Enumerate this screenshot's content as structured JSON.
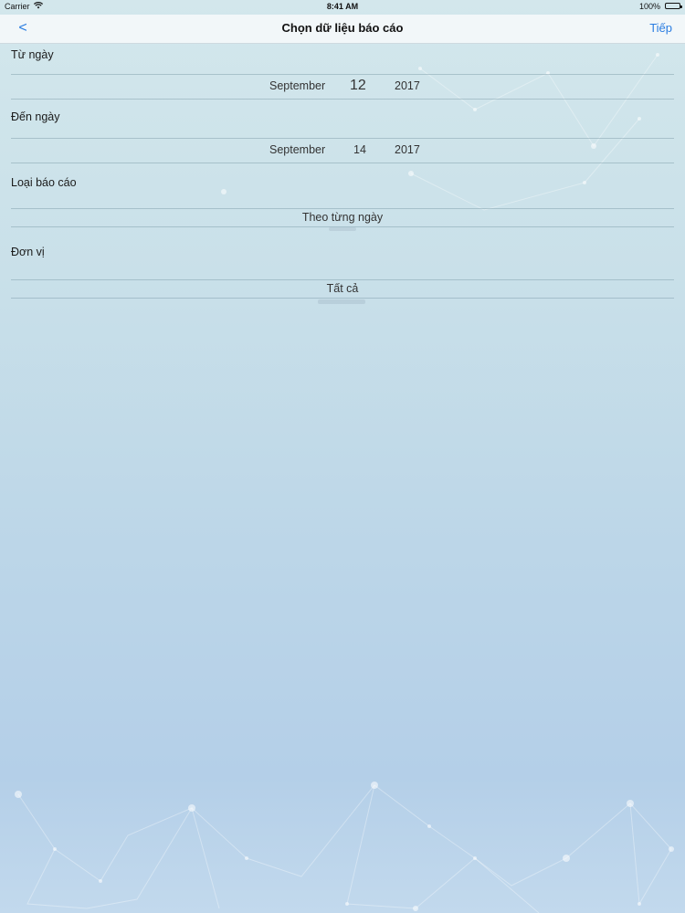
{
  "status_bar": {
    "carrier": "Carrier",
    "time": "8:41 AM",
    "battery": "100%"
  },
  "nav": {
    "back_label": "<",
    "title": "Chọn dữ liệu báo cáo",
    "next_label": "Tiếp"
  },
  "form": {
    "from_date": {
      "label": "Từ ngày",
      "month": "September",
      "day": "12",
      "year": "2017"
    },
    "to_date": {
      "label": "Đến ngày",
      "month": "September",
      "day": "14",
      "year": "2017"
    },
    "report_type": {
      "label": "Loại báo cáo",
      "value": "Theo từng ngày"
    },
    "unit": {
      "label": "Đơn vị",
      "value": "Tất cả"
    }
  },
  "colors": {
    "accent": "#2a7de1"
  }
}
